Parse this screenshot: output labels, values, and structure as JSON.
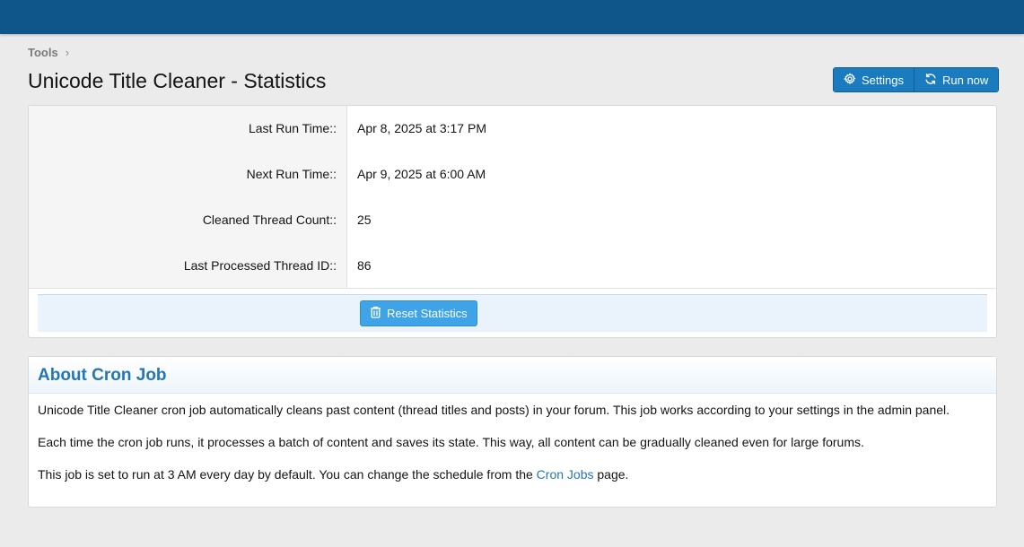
{
  "breadcrumb": {
    "items": [
      "Tools"
    ],
    "separator": "›"
  },
  "page": {
    "title": "Unicode Title Cleaner - Statistics"
  },
  "toolbar": {
    "settings_label": "Settings",
    "run_now_label": "Run now"
  },
  "stats": {
    "rows": [
      {
        "label": "Last Run Time::",
        "value": "Apr 8, 2025 at 3:17 PM"
      },
      {
        "label": "Next Run Time::",
        "value": "Apr 9, 2025 at 6:00 AM"
      },
      {
        "label": "Cleaned Thread Count::",
        "value": "25"
      },
      {
        "label": "Last Processed Thread ID::",
        "value": "86"
      }
    ],
    "reset_label": "Reset Statistics"
  },
  "about": {
    "title": "About Cron Job",
    "p1": "Unicode Title Cleaner cron job automatically cleans past content (thread titles and posts) in your forum. This job works according to your settings in the admin panel.",
    "p2": "Each time the cron job runs, it processes a batch of content and saves its state. This way, all content can be gradually cleaned even for large forums.",
    "p3_before": "This job is set to run at 3 AM every day by default. You can change the schedule from the ",
    "p3_link": "Cron Jobs",
    "p3_after": " page."
  },
  "icons": {
    "settings": "gear-icon",
    "run_now": "refresh-icon",
    "reset": "trash-icon",
    "separator": "chevron-right-icon"
  },
  "colors": {
    "topbar": "#0f578a",
    "primary_button": "#1a7bbf",
    "reset_button": "#3fa3e8",
    "link": "#2577b1"
  }
}
